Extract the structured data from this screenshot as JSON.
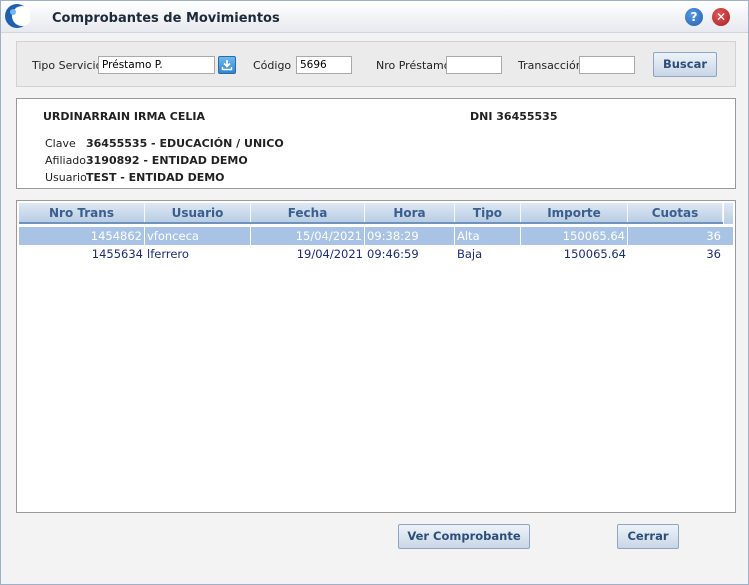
{
  "window": {
    "title": "Comprobantes de Movimientos",
    "help_label": "?",
    "close_label": "✕"
  },
  "search": {
    "tipo_servicio_label": "Tipo Servicio",
    "tipo_servicio_value": "Préstamo P.",
    "codigo_label": "Código",
    "codigo_value": "5696",
    "nro_prestamo_label": "Nro Préstamo",
    "nro_prestamo_value": "",
    "transaccion_label": "Transacción",
    "transaccion_value": "",
    "buscar_label": "Buscar"
  },
  "info": {
    "nombre": "URDINARRAIN IRMA CELIA",
    "dni": "DNI  36455535",
    "clave_label": "Clave",
    "clave_value": "36455535  -  EDUCACIÓN / UNICO",
    "afiliado_label": "Afiliado",
    "afiliado_value": "3190892  -  ENTIDAD DEMO",
    "usuario_label": "Usuario",
    "usuario_value": "TEST  -  ENTIDAD DEMO"
  },
  "table": {
    "columns": [
      "Nro Trans",
      "Usuario",
      "Fecha",
      "Hora",
      "Tipo",
      "Importe",
      "Cuotas"
    ],
    "rows": [
      [
        "1454862",
        "vfonceca",
        "15/04/2021",
        "09:38:29",
        "Alta",
        "150065.64",
        "36"
      ],
      [
        "1455634",
        "lferrero",
        "19/04/2021",
        "09:46:59",
        "Baja",
        "150065.64",
        "36"
      ]
    ]
  },
  "footer": {
    "ver_comprobante_label": "Ver Comprobante",
    "cerrar_label": "Cerrar"
  },
  "colors": {
    "accent": "#2b4e7a",
    "selected_row": "#a9c3e4",
    "header_text": "#3a5f8e"
  }
}
